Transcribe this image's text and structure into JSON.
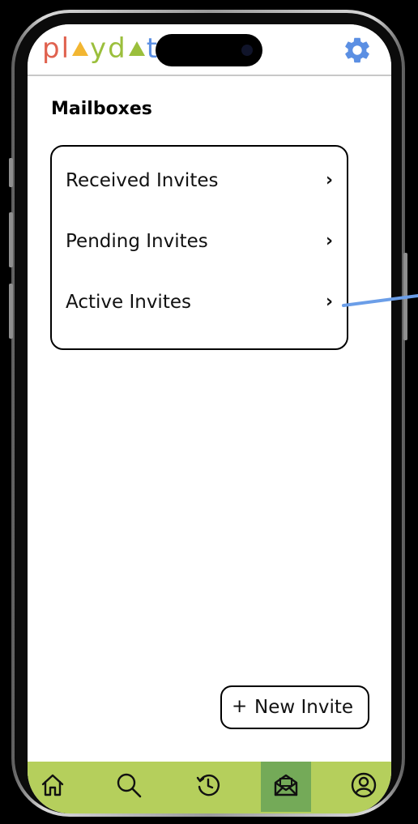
{
  "app": {
    "logo_letters": [
      {
        "char": "p",
        "color": "#e0624f"
      },
      {
        "char": "l",
        "color": "#e0624f"
      },
      {
        "char": "",
        "color": "#f2b632",
        "shape": "triangle"
      },
      {
        "char": "y",
        "color": "#9bbf3c"
      },
      {
        "char": "d",
        "color": "#9bbf3c"
      },
      {
        "char": "",
        "color": "#9bbf3c",
        "shape": "triangle"
      },
      {
        "char": "t",
        "color": "#5b8fe3"
      }
    ],
    "settings_icon": "gear-icon",
    "accent_color": "#5b8fe3"
  },
  "page": {
    "title": "Mailboxes"
  },
  "mailboxes": [
    {
      "label": "Received Invites",
      "chevron": "›"
    },
    {
      "label": "Pending Invites",
      "chevron": "›"
    },
    {
      "label": "Active Invites",
      "chevron": "›"
    }
  ],
  "actions": {
    "new_invite_plus": "+",
    "new_invite_label": "New Invite"
  },
  "bottom_nav": {
    "background": "#b5cf5c",
    "active_background": "#74aa58",
    "items": [
      {
        "icon": "home-icon"
      },
      {
        "icon": "search-icon"
      },
      {
        "icon": "history-icon"
      },
      {
        "icon": "mailbox-icon",
        "active": true
      },
      {
        "icon": "profile-icon"
      }
    ]
  }
}
